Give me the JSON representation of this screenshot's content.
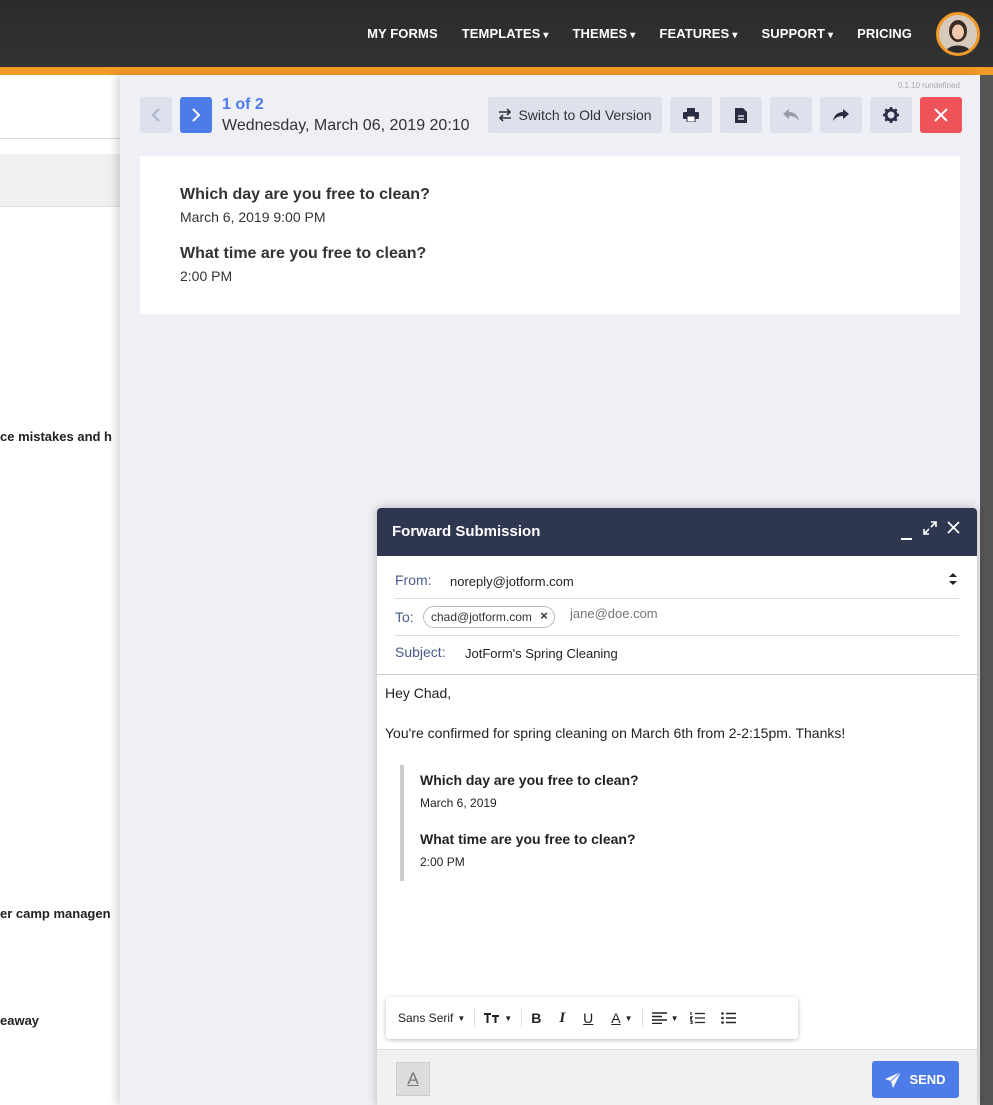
{
  "nav": {
    "items": [
      {
        "label": "MY FORMS",
        "caret": ""
      },
      {
        "label": "TEMPLATES",
        "caret": "▾"
      },
      {
        "label": "THEMES",
        "caret": "▾"
      },
      {
        "label": "FEATURES",
        "caret": "▾"
      },
      {
        "label": "SUPPORT",
        "caret": "▾"
      },
      {
        "label": "PRICING",
        "caret": ""
      }
    ]
  },
  "background_page": {
    "snippets": [
      "ce mistakes and h",
      "er camp managen",
      "eaway"
    ]
  },
  "panel": {
    "version": "0.1.10 rundefined",
    "counter": "1 of 2",
    "datetime": "Wednesday, March 06, 2019 20:10",
    "switch_label": "Switch to Old Version",
    "questions": [
      {
        "q": "Which day are you free to clean?",
        "a": "March 6, 2019 9:00 PM"
      },
      {
        "q": "What time are you free to clean?",
        "a": "2:00 PM"
      }
    ]
  },
  "modal": {
    "title": "Forward Submission",
    "from_label": "From:",
    "from_value": "noreply@jotform.com",
    "to_label": "To:",
    "to_chip": "chad@jotform.com",
    "to_placeholder": "jane@doe.com",
    "subject_label": "Subject:",
    "subject_value": "JotForm's Spring Cleaning",
    "greeting": "Hey Chad,",
    "message": "You're confirmed for spring cleaning on March 6th from 2-2:15pm. Thanks!",
    "quote": [
      {
        "q": "Which day are you free to clean?",
        "a": "March 6, 2019"
      },
      {
        "q": "What time are you free to clean?",
        "a": "2:00 PM"
      }
    ],
    "toolbar": {
      "font": "Sans Serif"
    },
    "send_label": "SEND"
  },
  "colors": {
    "accent": "#4d7ce8",
    "orange": "#f29a26",
    "danger": "#f0525a",
    "header": "#2f3650"
  }
}
